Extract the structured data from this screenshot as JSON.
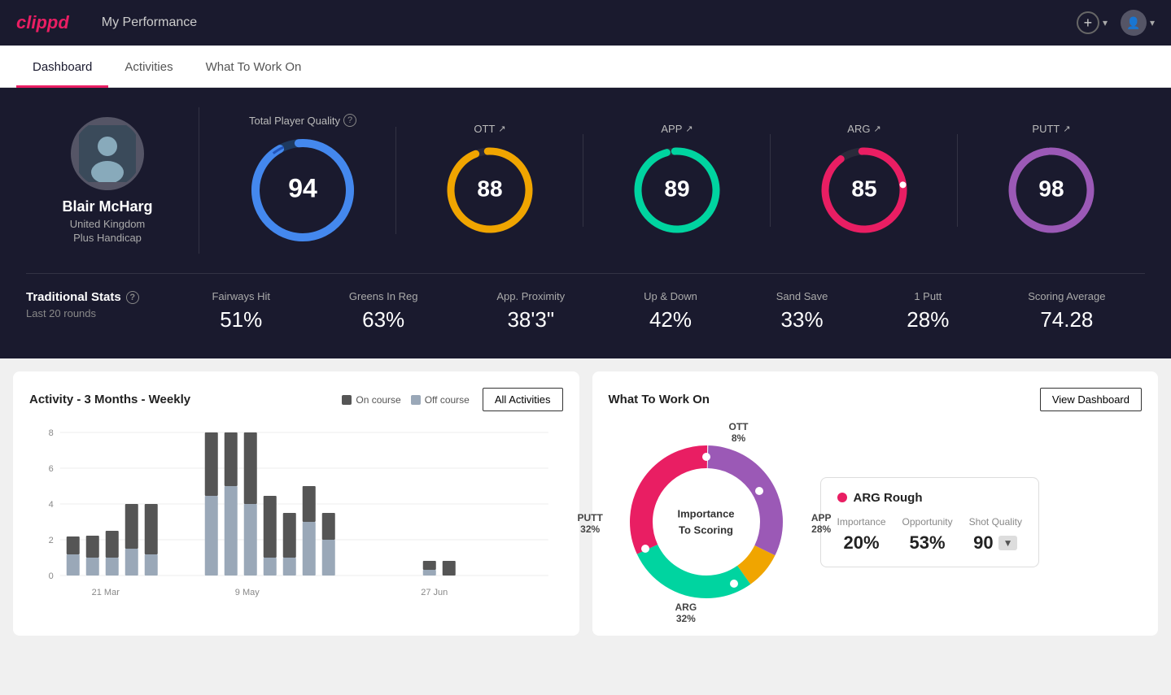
{
  "app": {
    "logo": "clippd",
    "header_title": "My Performance"
  },
  "nav": {
    "tabs": [
      {
        "id": "dashboard",
        "label": "Dashboard",
        "active": true
      },
      {
        "id": "activities",
        "label": "Activities",
        "active": false
      },
      {
        "id": "what-to-work-on",
        "label": "What To Work On",
        "active": false
      }
    ]
  },
  "player": {
    "name": "Blair McHarg",
    "country": "United Kingdom",
    "handicap": "Plus Handicap",
    "tpq_label": "Total Player Quality"
  },
  "gauges": {
    "tpq": {
      "value": 94,
      "color_start": "#4488ff",
      "color_end": "#3366ee"
    },
    "ott": {
      "label": "OTT",
      "value": 88,
      "color": "#f0a500"
    },
    "app": {
      "label": "APP",
      "value": 89,
      "color": "#00d4a0"
    },
    "arg": {
      "label": "ARG",
      "value": 85,
      "color": "#e91e63"
    },
    "putt": {
      "label": "PUTT",
      "value": 98,
      "color": "#9b59b6"
    }
  },
  "traditional_stats": {
    "title": "Traditional Stats",
    "subtitle": "Last 20 rounds",
    "items": [
      {
        "label": "Fairways Hit",
        "value": "51%"
      },
      {
        "label": "Greens In Reg",
        "value": "63%"
      },
      {
        "label": "App. Proximity",
        "value": "38'3\""
      },
      {
        "label": "Up & Down",
        "value": "42%"
      },
      {
        "label": "Sand Save",
        "value": "33%"
      },
      {
        "label": "1 Putt",
        "value": "28%"
      },
      {
        "label": "Scoring Average",
        "value": "74.28"
      }
    ]
  },
  "activity_chart": {
    "title": "Activity - 3 Months - Weekly",
    "legend_on_course": "On course",
    "legend_off_course": "Off course",
    "all_activities_btn": "All Activities",
    "x_labels": [
      "21 Mar",
      "9 May",
      "27 Jun"
    ],
    "bars": [
      {
        "on": 1,
        "off": 1.2
      },
      {
        "on": 1.2,
        "off": 1
      },
      {
        "on": 1.5,
        "off": 1
      },
      {
        "on": 2.5,
        "off": 1.5
      },
      {
        "on": 2.8,
        "off": 1.2
      },
      {
        "on": 4,
        "off": 4.5
      },
      {
        "on": 3,
        "off": 5
      },
      {
        "on": 4,
        "off": 4
      },
      {
        "on": 3.5,
        "off": 1
      },
      {
        "on": 2.5,
        "off": 1
      },
      {
        "on": 2,
        "off": 3
      },
      {
        "on": 1.5,
        "off": 2
      },
      {
        "on": 0.5,
        "off": 0.3
      },
      {
        "on": 0.8,
        "off": 0
      }
    ],
    "y_labels": [
      "0",
      "2",
      "4",
      "6",
      "8"
    ]
  },
  "what_to_work_on": {
    "title": "What To Work On",
    "view_dashboard_btn": "View Dashboard",
    "center_text_line1": "Importance",
    "center_text_line2": "To Scoring",
    "segments": [
      {
        "label": "OTT",
        "value": "8%",
        "color": "#f0a500"
      },
      {
        "label": "APP",
        "value": "28%",
        "color": "#00d4a0"
      },
      {
        "label": "ARG",
        "value": "32%",
        "color": "#e91e63"
      },
      {
        "label": "PUTT",
        "value": "32%",
        "color": "#9b59b6"
      }
    ],
    "arg_card": {
      "title": "ARG Rough",
      "metrics": [
        {
          "label": "Importance",
          "value": "20%"
        },
        {
          "label": "Opportunity",
          "value": "53%"
        },
        {
          "label": "Shot Quality",
          "value": "90",
          "badge": true
        }
      ]
    }
  }
}
